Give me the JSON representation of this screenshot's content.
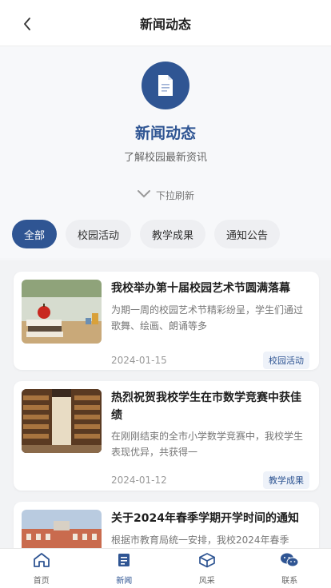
{
  "nav": {
    "title": "新闻动态"
  },
  "hero": {
    "title": "新闻动态",
    "subtitle": "了解校园最新资讯",
    "pull_hint": "下拉刷新"
  },
  "tabs": [
    {
      "label": "全部",
      "active": true
    },
    {
      "label": "校园活动",
      "active": false
    },
    {
      "label": "教学成果",
      "active": false
    },
    {
      "label": "通知公告",
      "active": false
    }
  ],
  "news": [
    {
      "title": "我校举办第十届校园艺术节圆满落幕",
      "desc": "为期一周的校园艺术节精彩纷呈，学生们通过歌舞、绘画、朗诵等多",
      "date": "2024-01-15",
      "tag": "校园活动",
      "thumb": "books-apple"
    },
    {
      "title": "热烈祝贺我校学生在市数学竞赛中获佳绩",
      "desc": "在刚刚结束的全市小学数学竞赛中，我校学生表现优异，共获得一",
      "date": "2024-01-12",
      "tag": "教学成果",
      "thumb": "library-shelves"
    },
    {
      "title": "关于2024年春季学期开学时间的通知",
      "desc": "根据市教育局统一安排，我校2024年春季",
      "date": "",
      "tag": "",
      "thumb": "campus-building"
    }
  ],
  "tabbar": [
    {
      "label": "首页",
      "icon": "home-icon",
      "active": false
    },
    {
      "label": "新闻",
      "icon": "news-icon",
      "active": true
    },
    {
      "label": "风采",
      "icon": "cube-icon",
      "active": false
    },
    {
      "label": "联系",
      "icon": "wechat-icon",
      "active": false
    }
  ],
  "colors": {
    "primary": "#2f5593"
  }
}
